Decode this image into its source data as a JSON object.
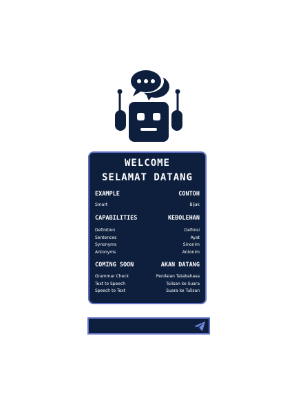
{
  "colors": {
    "navy": "#0e1f3d",
    "border": "#5f6fc4",
    "send": "#6f86e0"
  },
  "icons": {
    "robot": "robot-chat-icon",
    "send": "send-icon"
  },
  "card": {
    "title_en": "WELCOME",
    "title_ms": "SELAMAT DATANG",
    "example": {
      "heading_en": "EXAMPLE",
      "heading_ms": "CONTOH",
      "rows": [
        {
          "en": "Smart",
          "ms": "Bijak"
        }
      ]
    },
    "capabilities": {
      "heading_en": "CAPABILITIES",
      "heading_ms": "KEBOLEHAN",
      "rows": [
        {
          "en": "Definition",
          "ms": "Definisi"
        },
        {
          "en": "Sentences",
          "ms": "Ayat"
        },
        {
          "en": "Synonyms",
          "ms": "Sinonim"
        },
        {
          "en": "Antonyms",
          "ms": "Antonim"
        }
      ]
    },
    "coming_soon": {
      "heading_en": "COMING SOON",
      "heading_ms": "AKAN DATANG",
      "rows": [
        {
          "en": "Grammar Check",
          "ms": "Penilaian Tatabahasa"
        },
        {
          "en": "Text to Speech",
          "ms": "Tulisan ke Suara"
        },
        {
          "en": "Speech to Text",
          "ms": "Suara ke Tulisan"
        }
      ]
    }
  },
  "input": {
    "value": "",
    "placeholder": ""
  }
}
